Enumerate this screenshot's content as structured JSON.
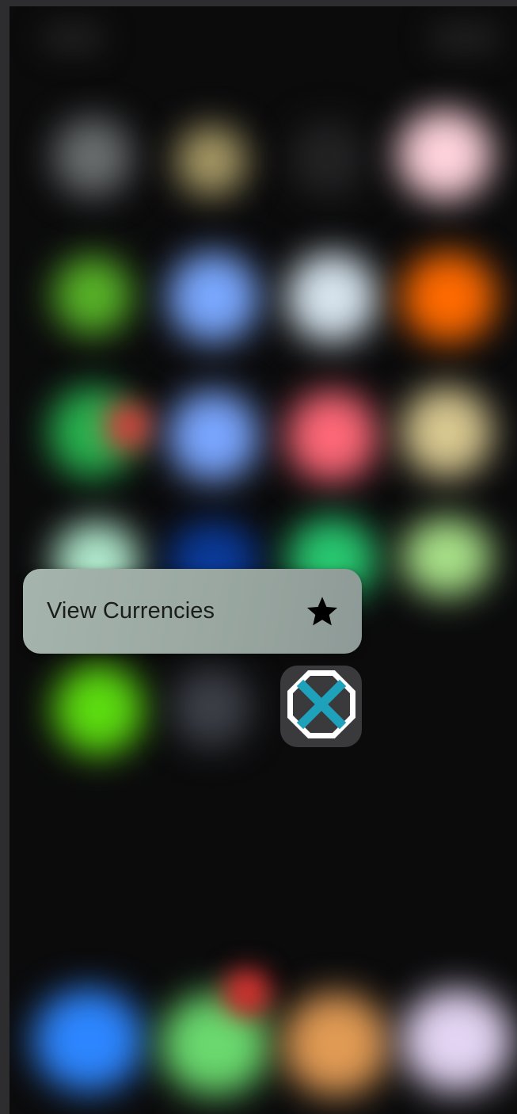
{
  "quick_action": {
    "label": "View Currencies",
    "icon": "star-icon"
  },
  "focused_app": {
    "icon": "octagon-x-logo-icon",
    "colors": {
      "accent": "#1ea2bb",
      "background": "#3a3a3c"
    }
  },
  "background": {
    "home_screen_blurred": true,
    "icon_colors": [
      [
        "#6a6e6e",
        "#a89a66",
        "#2a2a2b",
        "#ffd0dc"
      ],
      [
        "#58b428",
        "#7aa8ff",
        "#d8e6f0",
        "#ff6a00"
      ],
      [
        "#28b450",
        "#7aa6ff",
        "#ff6878",
        "#d8c890"
      ],
      [
        "#b0e8cc",
        "#0a3a9a",
        "#28c870",
        "#a8e088"
      ],
      [
        "#5cdc10",
        "#3c4048",
        null,
        null
      ]
    ],
    "dock_colors": [
      "#2d86ff",
      "#6ad86e",
      "#e09a54",
      "#e2d4f2"
    ]
  }
}
